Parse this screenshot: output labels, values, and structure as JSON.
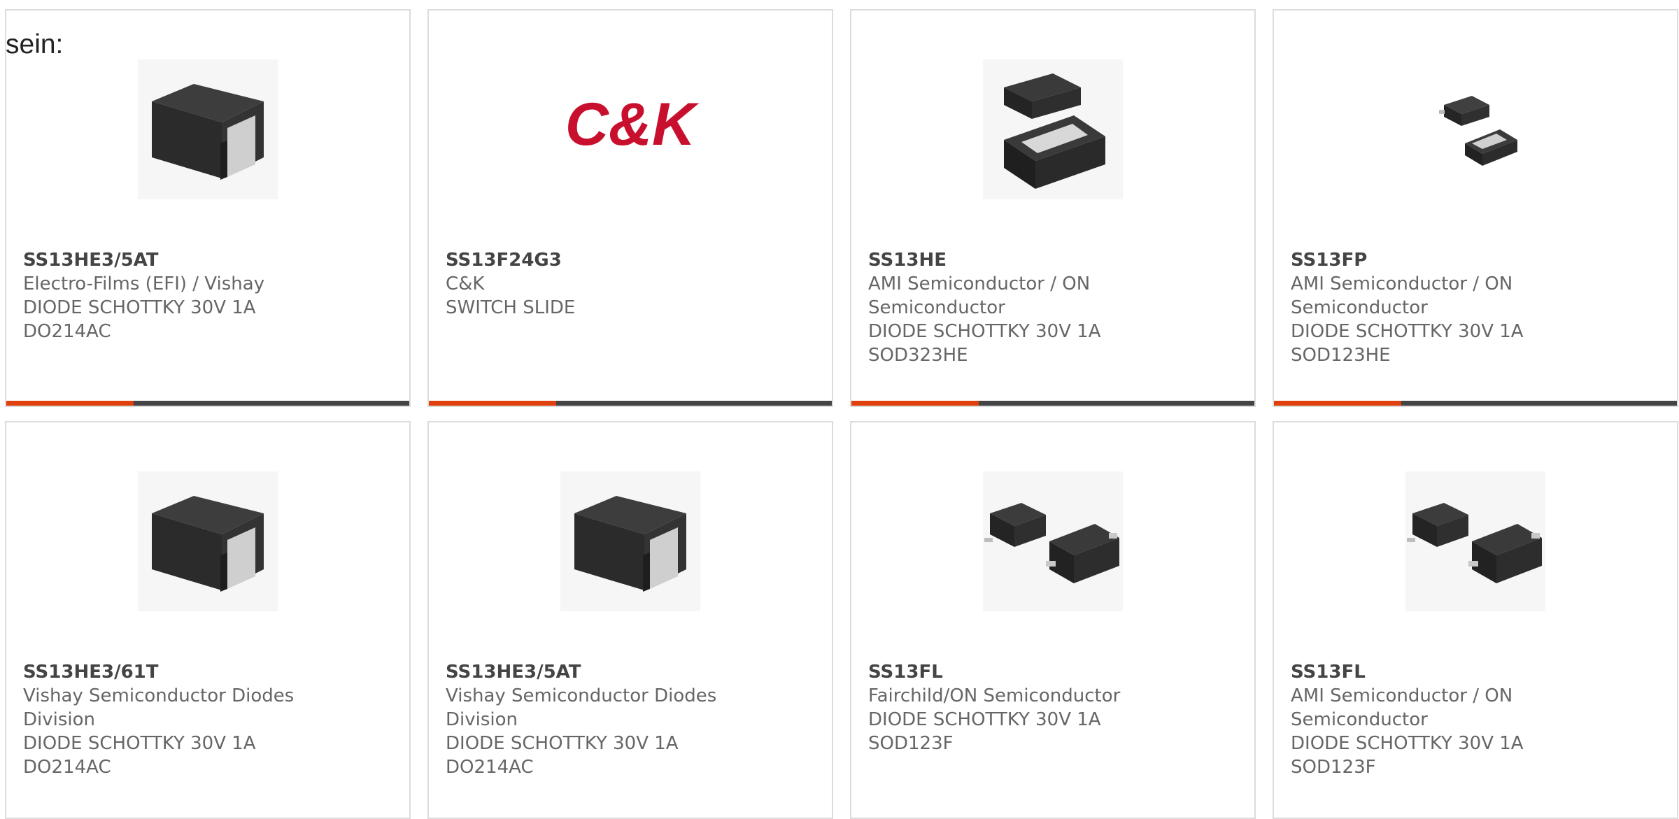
{
  "intro_text": "sein:",
  "products": [
    {
      "part": "SS13HE3/5AT",
      "manufacturer": "Electro-Films (EFI) / Vishay",
      "description": "DIODE SCHOTTKY 30V 1A",
      "package": "DO214AC",
      "image": "smd-diode-do214ac-image"
    },
    {
      "part": "SS13F24G3",
      "manufacturer": "C&K",
      "description": "SWITCH SLIDE",
      "package": "",
      "image": "ck-logo-image",
      "logo_text": "C&K"
    },
    {
      "part": "SS13HE",
      "manufacturer": "AMI Semiconductor / ON Semiconductor",
      "description": "DIODE SCHOTTKY 30V 1A",
      "package": "SOD323HE",
      "image": "smd-diode-sod323he-image"
    },
    {
      "part": "SS13FP",
      "manufacturer": "AMI Semiconductor / ON Semiconductor",
      "description": "DIODE SCHOTTKY 30V 1A",
      "package": "SOD123HE",
      "image": "smd-diode-sod123he-image"
    },
    {
      "part": "SS13HE3/61T",
      "manufacturer": "Vishay Semiconductor Diodes Division",
      "description": "DIODE SCHOTTKY 30V 1A",
      "package": "DO214AC",
      "image": "smd-diode-do214ac-image"
    },
    {
      "part": "SS13HE3/5AT",
      "manufacturer": "Vishay Semiconductor Diodes Division",
      "description": "DIODE SCHOTTKY 30V 1A",
      "package": "DO214AC",
      "image": "smd-diode-do214ac-image"
    },
    {
      "part": "SS13FL",
      "manufacturer": "Fairchild/ON Semiconductor",
      "description": "DIODE SCHOTTKY 30V 1A",
      "package": "SOD123F",
      "image": "smd-diode-sod123f-image"
    },
    {
      "part": "SS13FL",
      "manufacturer": "AMI Semiconductor / ON Semiconductor",
      "description": "DIODE SCHOTTKY 30V 1A",
      "package": "SOD123F",
      "image": "smd-diode-sod123f-image"
    }
  ],
  "colors": {
    "accent": "#e0400c",
    "bar": "#444444",
    "border": "#dcdcdc",
    "logo_red": "#c8102e"
  }
}
